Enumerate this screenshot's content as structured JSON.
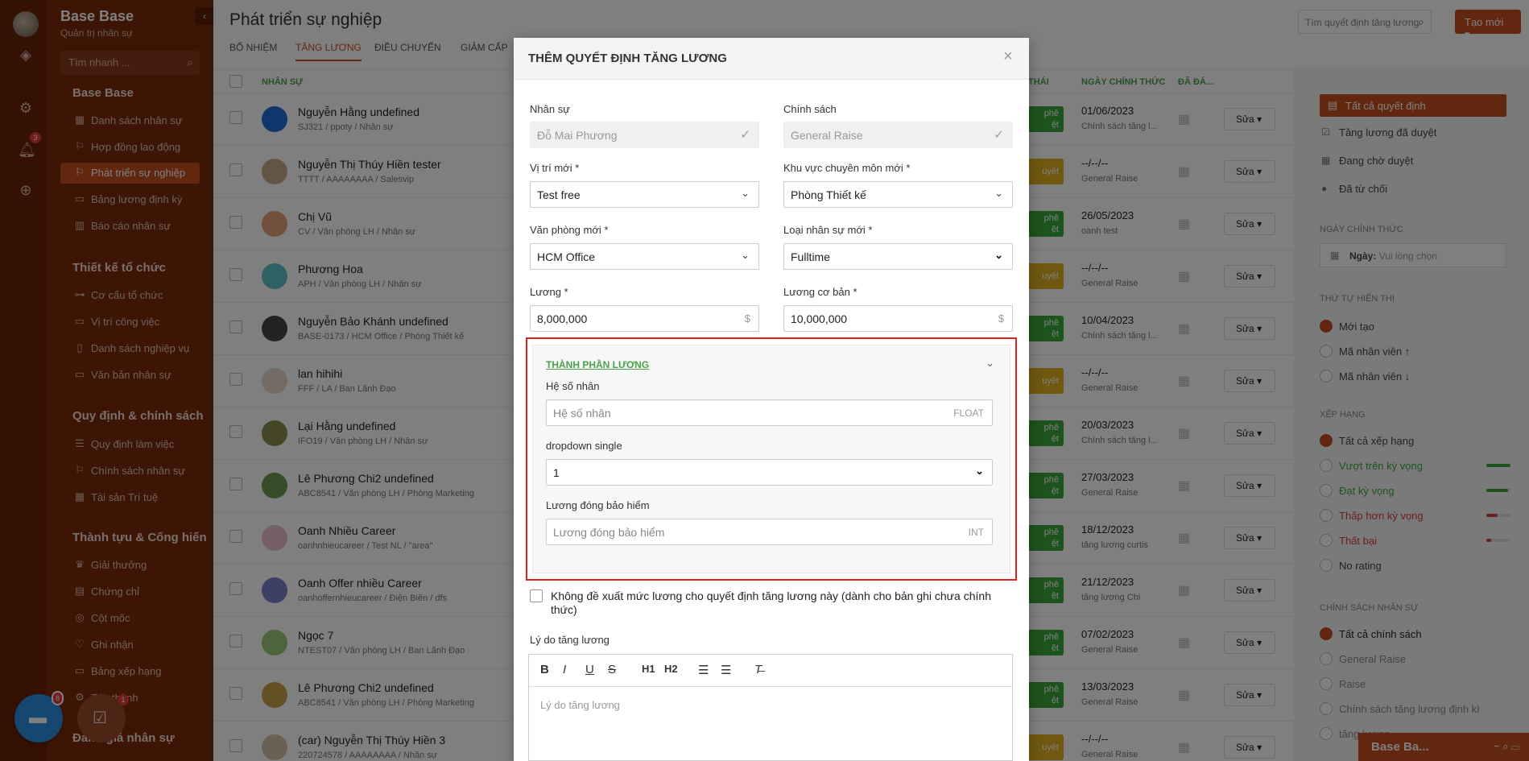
{
  "rail": {
    "notif_count": "3"
  },
  "sidebar": {
    "brand": "Base Base",
    "brand_sub": "Quản trị nhân sự",
    "quick_search": "Tìm nhanh ...",
    "sections": [
      {
        "title": "Base Base",
        "items": [
          "Danh sách nhân sự",
          "Hợp đồng lao động",
          "Phát triển sự nghiệp",
          "Bảng lương định kỳ",
          "Báo cáo nhân sự"
        ]
      },
      {
        "title": "Thiết kế tổ chức",
        "items": [
          "Cơ cấu tổ chức",
          "Vị trí công việc",
          "Danh sách nghiệp vụ",
          "Văn bản nhân sự"
        ]
      },
      {
        "title": "Quy định & chính sách",
        "items": [
          "Quy định làm việc",
          "Chính sách nhân sự",
          "Tài sản Trí tuệ"
        ]
      },
      {
        "title": "Thành tựu & Cống hiến",
        "items": [
          "Giải thưởng",
          "Chứng chỉ",
          "Cột mốc",
          "Ghi nhận",
          "Bảng xếp hạng",
          "Tán thành"
        ]
      },
      {
        "title": "Đánh giá nhân sự",
        "items": []
      }
    ],
    "chat_badge": "8",
    "task_badge": "1"
  },
  "main": {
    "title": "Phát triển sự nghiệp",
    "tabs": [
      "BỔ NHIỆM",
      "TĂNG LƯƠNG",
      "ĐIỀU CHUYỂN",
      "GIẢM CẤP"
    ],
    "search_placeholder": "Tìm quyết định tăng lương",
    "new_button": "Tạo mới",
    "headers": {
      "staff": "NHÂN SỰ",
      "status": "THÁI",
      "date": "NGÀY CHÍNH THỨC",
      "done": "ĐÃ ĐÁ..."
    },
    "edit_label": "Sửa",
    "rows": [
      {
        "name": "Nguyễn Hằng undefined",
        "sub": "SJ321 / ppoty / Nhân sự",
        "status": "phê\nệt",
        "date": "01/06/2023",
        "date_sub": "Chính sách tăng l..."
      },
      {
        "name": "Nguyễn Thị Thúy Hiền tester",
        "sub": "TTTT / AAAAAAAA / Salesvip",
        "status": "uyệt",
        "date": "--/--/--",
        "date_sub": "General Raise"
      },
      {
        "name": "Chị Vũ",
        "sub": "CV / Văn phòng LH / Nhân sự",
        "status": "phê\nệt",
        "date": "26/05/2023",
        "date_sub": "oanh test"
      },
      {
        "name": "Phương Hoa",
        "sub": "APH / Văn phòng LH / Nhân sự",
        "status": "uyệt",
        "date": "--/--/--",
        "date_sub": "General Raise"
      },
      {
        "name": "Nguyễn Bảo Khánh undefined",
        "sub": "BASE-0173 / HCM Office / Phòng Thiết kế",
        "status": "phê\nệt",
        "date": "10/04/2023",
        "date_sub": "Chính sách tăng l..."
      },
      {
        "name": "lan hihihi",
        "sub": "FFF / LA / Ban Lãnh Đạo",
        "status": "uyệt",
        "date": "--/--/--",
        "date_sub": "General Raise"
      },
      {
        "name": "Lại Hằng undefined",
        "sub": "IFO19 / Văn phòng LH / Nhân sự",
        "status": "phê\nệt",
        "date": "20/03/2023",
        "date_sub": "Chính sách tăng l..."
      },
      {
        "name": "Lê Phương Chi2 undefined",
        "sub": "ABC8541 / Văn phòng LH / Phòng Marketing",
        "status": "phê\nệt",
        "date": "27/03/2023",
        "date_sub": "General Raise"
      },
      {
        "name": "Oanh Nhiều Career",
        "sub": "oanhnhieucareer / Test NL / \"area\"",
        "status": "phê\nệt",
        "date": "18/12/2023",
        "date_sub": "tăng lương curtis"
      },
      {
        "name": "Oanh Offer nhiều Career",
        "sub": "oanhoffernhieucareer / Điện Biên / dfs",
        "status": "phê\nệt",
        "date": "21/12/2023",
        "date_sub": "tăng lương Chi"
      },
      {
        "name": "Ngọc 7",
        "sub": "NTEST07 / Văn phòng LH / Ban Lãnh Đạo",
        "status": "phê\nệt",
        "date": "07/02/2023",
        "date_sub": "General Raise"
      },
      {
        "name": "Lê Phương Chi2 undefined",
        "sub": "ABC8541 / Văn phòng LH / Phòng Marketing",
        "status": "phê\nệt",
        "date": "13/03/2023",
        "date_sub": "General Raise"
      },
      {
        "name": "(car) Nguyễn Thị Thúy Hiền 3",
        "sub": "220724578 / AAAAAAAA / Nhân sự",
        "status": "uyệt",
        "date": "--/--/--",
        "date_sub": "General Raise"
      }
    ]
  },
  "right": {
    "all": "Tất cả quyết định",
    "approved": "Tăng lương đã duyệt",
    "pending": "Đang chờ duyệt",
    "rejected": "Đã từ chối",
    "date_head": "NGÀY CHÍNH THỨC",
    "date_label": "Ngày:",
    "date_placeholder": "Vui lòng chọn",
    "order_head": "THỨ TỰ HIỂN THỊ",
    "order": [
      "Mới tạo",
      "Mã nhân viên ↑",
      "Mã nhân viên ↓"
    ],
    "rank_head": "XẾP HẠNG",
    "ranks": [
      "Tất cả xếp hạng",
      "Vượt trên kỳ vọng",
      "Đạt kỳ vọng",
      "Thấp hơn kỳ vọng",
      "Thất bại",
      "No rating"
    ],
    "policy_head": "CHÍNH SÁCH NHÂN SỰ",
    "policies": [
      "Tất cả chính sách",
      "General Raise",
      "Raise",
      "Chính sách tăng lương định kì",
      "tăng lương"
    ],
    "mini_title": "Base Ba..."
  },
  "modal": {
    "title": "THÊM QUYẾT ĐỊNH TĂNG LƯƠNG",
    "staff_label": "Nhân sự",
    "staff_value": "Đỗ Mai Phương",
    "policy_label": "Chính sách",
    "policy_value": "General Raise",
    "position_label": "Vị trí mới *",
    "position_value": "Test free",
    "area_label": "Khu vực chuyên môn mới *",
    "area_value": "Phòng Thiết kế",
    "office_label": "Văn phòng mới *",
    "office_value": "HCM Office",
    "type_label": "Loại nhân sự mới *",
    "type_value": "Fulltime",
    "salary_label": "Lương *",
    "salary_value": "8,000,000",
    "base_label": "Lương cơ bản *",
    "base_value": "10,000,000",
    "currency": "$",
    "component_title": "THÀNH PHẦN LƯƠNG",
    "coef_label": "Hệ số nhân",
    "coef_placeholder": "Hệ số nhân",
    "coef_type": "FLOAT",
    "dropdown_label": "dropdown single",
    "dropdown_value": "1",
    "insurance_label": "Lương đóng bảo hiểm",
    "insurance_placeholder": "Lương đóng bảo hiểm",
    "insurance_type": "INT",
    "no_propose": "Không đề xuất mức lương cho quyết định tăng lương này (dành cho bản ghi chưa chính thức)",
    "reason_label": "Lý do tăng lương",
    "reason_placeholder": "Lý do tăng lương"
  }
}
